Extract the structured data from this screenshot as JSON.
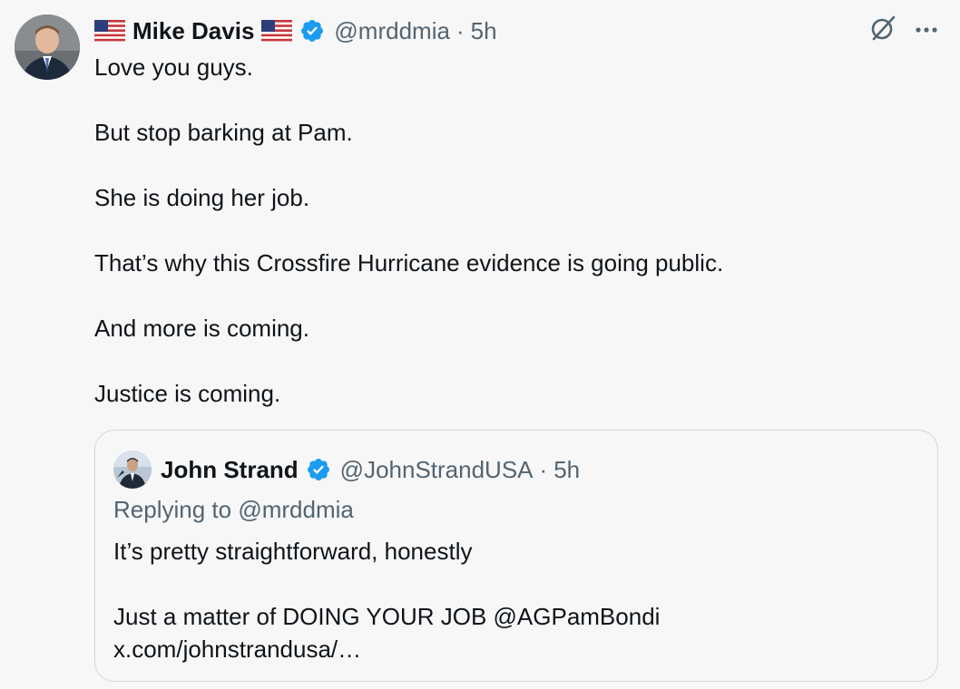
{
  "tweet": {
    "author": {
      "name": "Mike Davis",
      "handle": "@mrddmia",
      "time": "5h",
      "separator": "·"
    },
    "paragraphs": [
      "Love you guys.",
      "But stop barking at Pam.",
      "She is doing her job.",
      "That’s why this Crossfire Hurricane evidence is going public.",
      "And more is coming.",
      "Justice is coming."
    ],
    "actions": {
      "grok_icon": "grok-icon",
      "more_label": "•••"
    }
  },
  "quote": {
    "author": {
      "name": "John Strand",
      "handle": "@JohnStrandUSA",
      "time": "5h",
      "separator": "·"
    },
    "replying_prefix": "Replying to ",
    "replying_handle": "@mrddmia",
    "paragraph1": "It’s pretty straightforward, honestly",
    "paragraph2_line1": "Just a matter of DOING YOUR JOB @AGPamBondi",
    "paragraph2_line2": "x.com/johnstrandusa/…"
  },
  "colors": {
    "background": "#f7f7f7",
    "text": "#0f1419",
    "secondary": "#536471",
    "verified": "#1d9bf0",
    "border": "#cfd9de"
  }
}
